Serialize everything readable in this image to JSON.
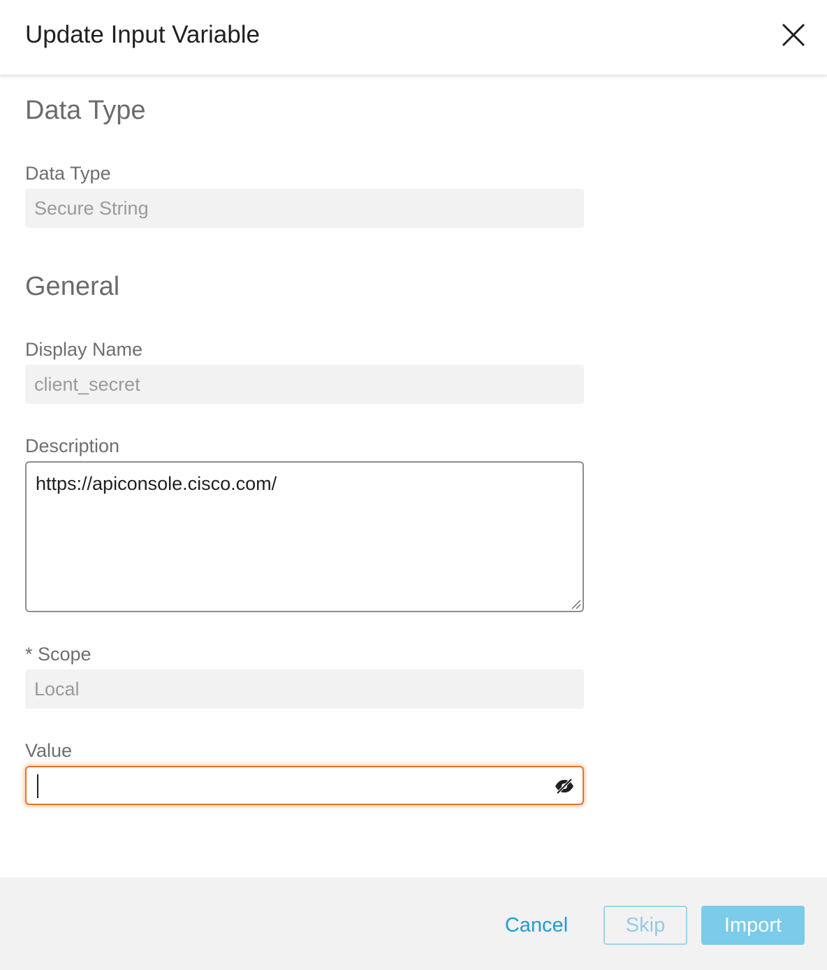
{
  "dialog": {
    "title": "Update Input Variable"
  },
  "sections": {
    "data_type_title": "Data Type",
    "general_title": "General"
  },
  "fields": {
    "data_type": {
      "label": "Data Type",
      "value": "Secure String"
    },
    "display_name": {
      "label": "Display Name",
      "value": "client_secret"
    },
    "description": {
      "label": "Description",
      "value": "https://apiconsole.cisco.com/"
    },
    "scope": {
      "label": "* Scope",
      "value": "Local"
    },
    "value": {
      "label": "Value",
      "value": ""
    }
  },
  "footer": {
    "cancel_label": "Cancel",
    "skip_label": "Skip",
    "import_label": "Import"
  },
  "icons": {
    "close": "close-icon",
    "visibility": "eye-off-icon",
    "resize": "resize-grip-icon"
  },
  "colors": {
    "accent": "#1f9cd1",
    "focus_border": "#e2752b",
    "primary_disabled": "#7bcbea"
  }
}
